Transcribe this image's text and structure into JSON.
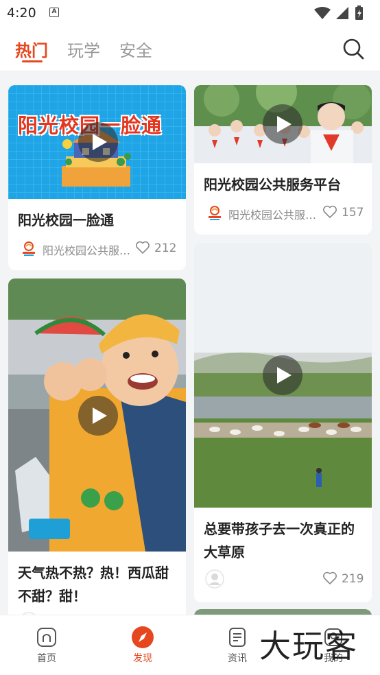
{
  "status_bar": {
    "time": "4:20",
    "notification_glyph": "A"
  },
  "top_nav": {
    "tabs": [
      {
        "label": "热门",
        "active": true
      },
      {
        "label": "玩学",
        "active": false
      },
      {
        "label": "安全",
        "active": false
      }
    ],
    "search_icon": "search-icon",
    "accent_color": "#e5481f"
  },
  "feed": {
    "cards": [
      {
        "title": "阳光校园一脸通",
        "poster_text": "阳光校园一脸通",
        "author": "阳光校园公共服…",
        "likes": "212",
        "has_video": true
      },
      {
        "title": "阳光校园公共服务平台",
        "author": "阳光校园公共服…",
        "likes": "157",
        "has_video": true
      },
      {
        "title": "天气热不热？热！西瓜甜不甜？甜！",
        "author": "",
        "likes": "",
        "has_video": true
      },
      {
        "title": "总要带孩子去一次真正的大草原",
        "author": "",
        "likes": "219",
        "has_video": true
      }
    ]
  },
  "bottom_nav": {
    "items": [
      {
        "label": "首页",
        "icon": "home-icon",
        "active": false
      },
      {
        "label": "发现",
        "icon": "compass-icon",
        "active": true
      },
      {
        "label": "资讯",
        "icon": "news-icon",
        "active": false
      },
      {
        "label": "我的",
        "icon": "profile-icon",
        "active": false
      }
    ]
  },
  "watermark": "大玩客"
}
